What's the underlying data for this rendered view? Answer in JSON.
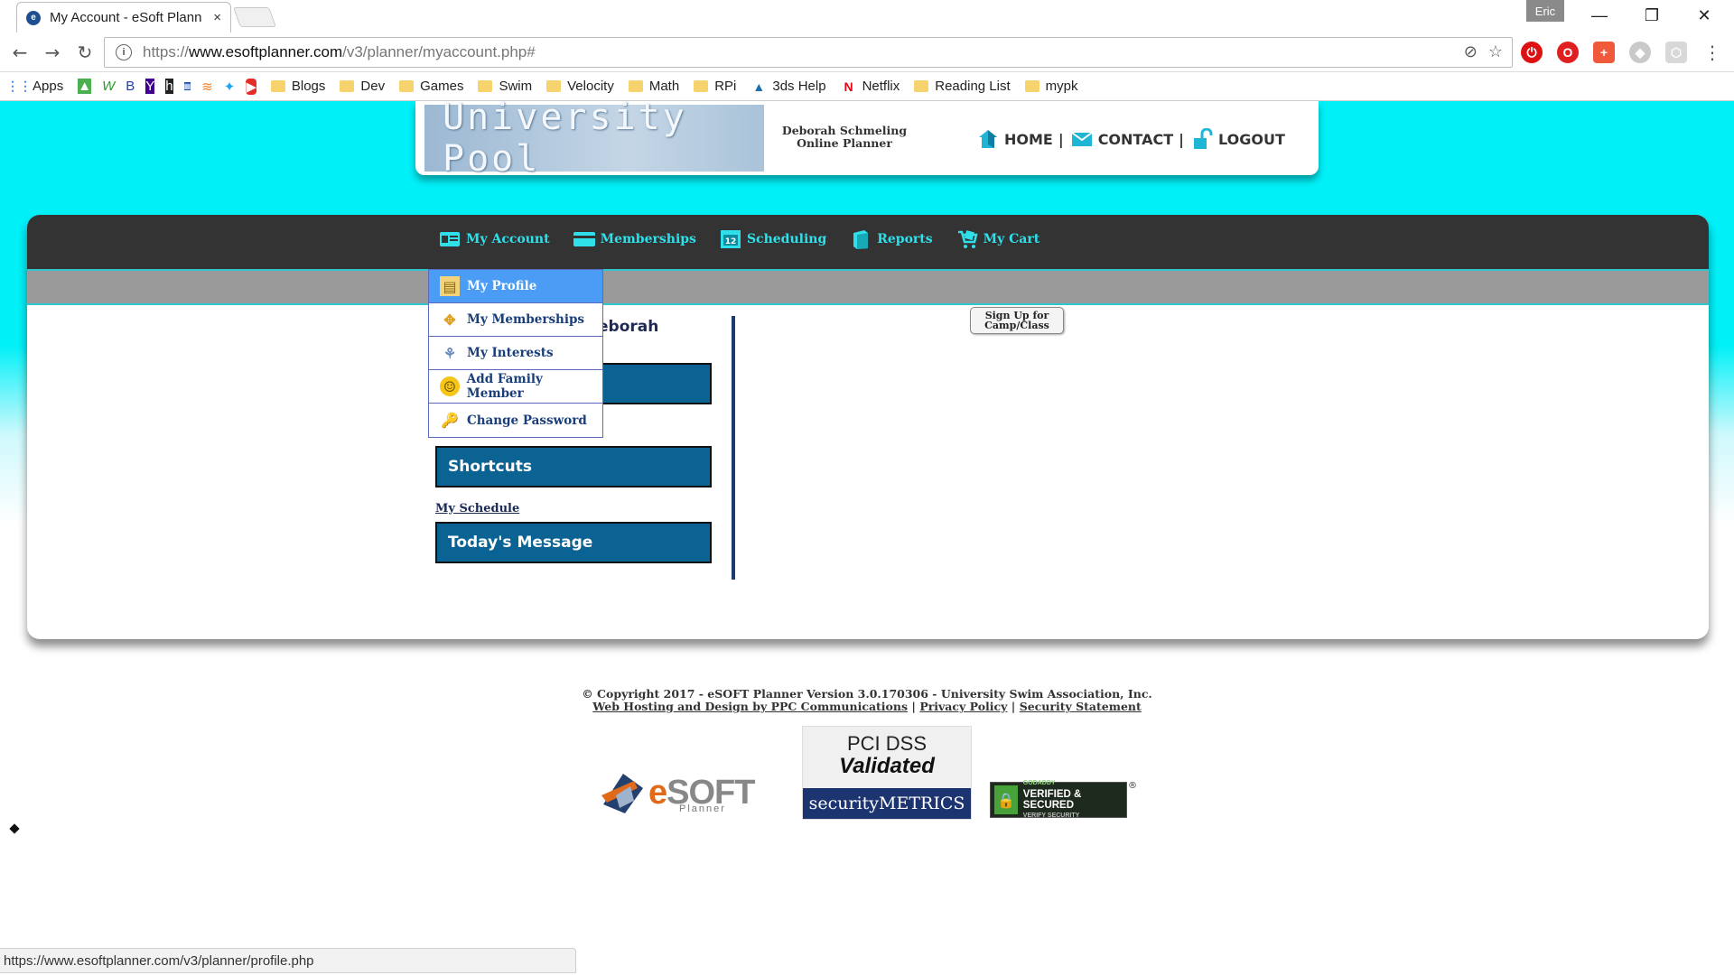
{
  "browser": {
    "tab_title": "My Account - eSoft Plann",
    "tab_close": "×",
    "favicon": "e",
    "user_name": "Eric",
    "window_controls": {
      "minimize": "—",
      "restore": "❐",
      "close": "✕"
    },
    "url_prefix": "https://",
    "url_host": "www.esoftplanner.com",
    "url_path": "/v3/planner/myaccount.php#",
    "bookmarks": [
      {
        "label": "Apps",
        "icon": "apps-grid-icon"
      },
      {
        "label": "Blogs",
        "icon": "folder-icon"
      },
      {
        "label": "Dev",
        "icon": "folder-icon"
      },
      {
        "label": "Games",
        "icon": "folder-icon"
      },
      {
        "label": "Swim",
        "icon": "folder-icon"
      },
      {
        "label": "Velocity",
        "icon": "folder-icon"
      },
      {
        "label": "Math",
        "icon": "folder-icon"
      },
      {
        "label": "RPi",
        "icon": "folder-icon"
      },
      {
        "label": "3ds Help",
        "icon": "autodesk-icon"
      },
      {
        "label": "Netflix",
        "icon": "netflix-icon"
      },
      {
        "label": "Reading List",
        "icon": "folder-icon"
      },
      {
        "label": "mypk",
        "icon": "folder-icon"
      }
    ],
    "status_url": "https://www.esoftplanner.com/v3/planner/profile.php"
  },
  "header": {
    "logo_text": "University Pool",
    "owner_name": "Deborah Schmeling",
    "owner_role": "Online Planner",
    "nav": {
      "home": "HOME",
      "contact": "CONTACT",
      "logout": "LOGOUT",
      "separator": "|"
    }
  },
  "menu": {
    "items": [
      {
        "label": "My Account",
        "icon": "id-card-icon"
      },
      {
        "label": "Memberships",
        "icon": "credit-card-icon"
      },
      {
        "label": "Scheduling",
        "icon": "calendar-icon",
        "badge": "12"
      },
      {
        "label": "Reports",
        "icon": "book-icon"
      },
      {
        "label": "My Cart",
        "icon": "cart-icon"
      }
    ],
    "dropdown": [
      {
        "label": "My Profile",
        "icon": "profile-icon",
        "active": true
      },
      {
        "label": "My Memberships",
        "icon": "memberships-icon"
      },
      {
        "label": "My Interests",
        "icon": "interests-icon"
      },
      {
        "label": "Add Family Member",
        "icon": "smiley-icon"
      },
      {
        "label": "Change Password",
        "icon": "key-icon"
      }
    ]
  },
  "content": {
    "welcome_partial": "eborah",
    "shortcuts_title": "Shortcuts",
    "shortcut_link": "My Schedule",
    "message_title": "Today's Message",
    "signup_line1": "Sign Up for",
    "signup_line2": "Camp/Class"
  },
  "footer": {
    "copyright": "© Copyright 2017 - eSOFT Planner Version 3.0.170306 - University Swim Association, Inc.",
    "hosting_link": "Web Hosting and Design by PPC Communications",
    "privacy_link": "Privacy Policy",
    "security_link": "Security Statement",
    "separator": "|",
    "esoft_logo_e": "e",
    "esoft_logo_rest": "SOFT",
    "esoft_logo_sub": "Planner",
    "pci_line1": "PCI DSS",
    "pci_line2": "Validated",
    "pci_line3": "securityMETRICS",
    "godaddy_small": "GODADDY",
    "godaddy_main": "VERIFIED & SECURED",
    "godaddy_sub": "VERIFY SECURITY",
    "godaddy_reg": "®"
  },
  "colors": {
    "page_bg_top": "#00f0f8",
    "menubar_bg": "#333333",
    "menu_text": "#2fe0ea",
    "box_blue": "#0b6394",
    "dropdown_active": "#4a9cf5"
  }
}
